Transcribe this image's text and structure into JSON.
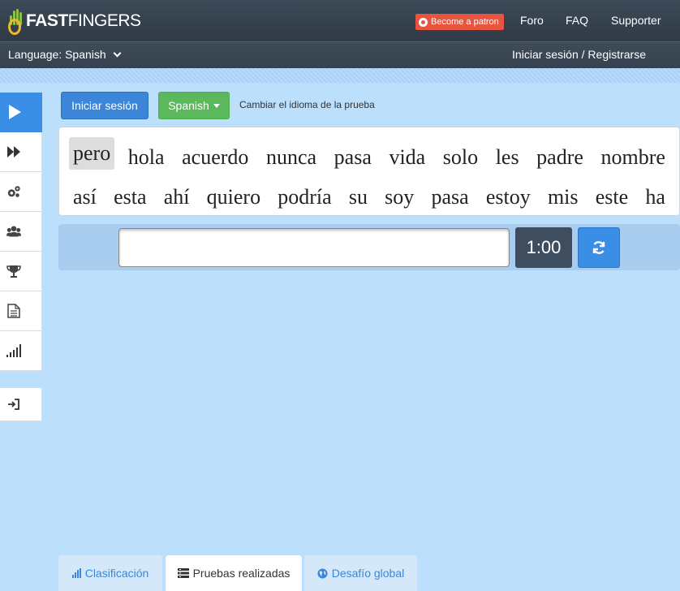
{
  "header": {
    "logo_text_bold": "FAST",
    "logo_text": "FINGERS",
    "patron_label": "Become a patron",
    "nav": [
      "Foro",
      "FAQ",
      "Supporter"
    ]
  },
  "subbar": {
    "language_label": "Language: Spanish",
    "login_register": "Iniciar sesión / Registrarse"
  },
  "sidebar": {
    "icons": [
      "play-icon",
      "fast-forward-icon",
      "gears-icon",
      "users-icon",
      "trophy-icon",
      "document-icon",
      "signal-bars-icon",
      "sign-in-icon"
    ],
    "active_index": 0
  },
  "toolbar": {
    "login_button": "Iniciar sesión",
    "language_button": "Spanish",
    "change_language_text": "Cambiar el idioma de la prueba"
  },
  "words": {
    "line1": [
      "pero",
      "hola",
      "acuerdo",
      "nunca",
      "pasa",
      "vida",
      "solo",
      "les",
      "padre",
      "nombre"
    ],
    "line2": [
      "así",
      "esta",
      "ahí",
      "quiero",
      "podría",
      "su",
      "soy",
      "pasa",
      "estoy",
      "mis",
      "este",
      "ha"
    ],
    "current_index": 0
  },
  "typing": {
    "input_value": "",
    "timer": "1:00"
  },
  "tabs": [
    {
      "label": "Clasificación",
      "icon": "bar-chart-icon",
      "active": false
    },
    {
      "label": "Pruebas realizadas",
      "icon": "list-icon",
      "active": true
    },
    {
      "label": "Desafío global",
      "icon": "globe-icon",
      "active": false
    }
  ],
  "colors": {
    "brand_blue": "#3a8ee6",
    "brand_green": "#5cb85c",
    "patron_red": "#e9543e",
    "navbar": "#36424f",
    "page_bg": "#bcdffb"
  }
}
